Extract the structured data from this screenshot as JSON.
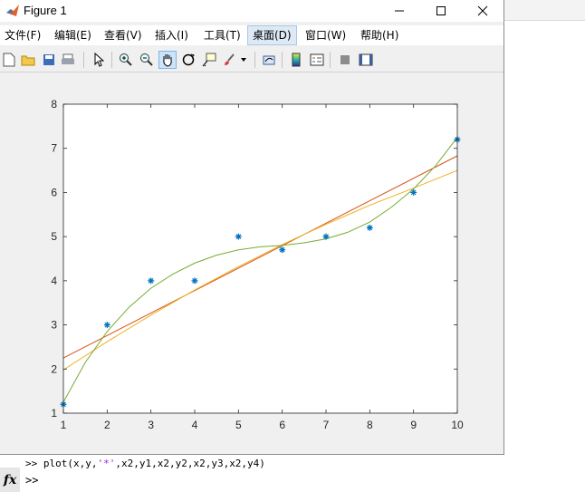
{
  "window": {
    "title": "Figure 1"
  },
  "menu": [
    {
      "label": "文件(F)"
    },
    {
      "label": "编辑(E)"
    },
    {
      "label": "查看(V)"
    },
    {
      "label": "插入(I)"
    },
    {
      "label": "工具(T)"
    },
    {
      "label": "桌面(D)"
    },
    {
      "label": "窗口(W)"
    },
    {
      "label": "帮助(H)"
    }
  ],
  "colors": {
    "markers": "#0072bd",
    "series_red": "#d95319",
    "series_yellow": "#edb120",
    "series_green": "#77ac30"
  },
  "command": {
    "prompt": ">>",
    "line1_prefix": "plot(x,y,",
    "line1_string": "'*'",
    "line1_suffix": ",x2,y1,x2,y2,x2,y3,x2,y4)",
    "line2": ">>",
    "fx": "fx"
  },
  "chart_data": {
    "type": "line",
    "xlim": [
      1,
      10
    ],
    "ylim": [
      1,
      8
    ],
    "xticks": [
      1,
      2,
      3,
      4,
      5,
      6,
      7,
      8,
      9,
      10
    ],
    "yticks": [
      1,
      2,
      3,
      4,
      5,
      6,
      7,
      8
    ],
    "grid": false,
    "markers": {
      "x": [
        1,
        2,
        3,
        4,
        5,
        6,
        7,
        8,
        9,
        10
      ],
      "y": [
        1.2,
        3.0,
        4.0,
        4.0,
        5.0,
        4.7,
        5.0,
        5.2,
        6.0,
        7.2
      ]
    },
    "series": [
      {
        "color": "#d95319",
        "x": [
          1,
          10
        ],
        "y": [
          2.25,
          6.83
        ]
      },
      {
        "color": "#edb120",
        "x": [
          1,
          2,
          3,
          4,
          5,
          6,
          7,
          8,
          9,
          10
        ],
        "y": [
          1.98,
          2.62,
          3.22,
          3.79,
          4.32,
          4.82,
          5.28,
          5.71,
          6.1,
          6.5
        ]
      },
      {
        "color": "#77ac30",
        "x": [
          1,
          1.5,
          2,
          2.5,
          3,
          3.5,
          4,
          4.5,
          5,
          5.5,
          6,
          6.5,
          7,
          7.5,
          8,
          8.5,
          9,
          9.5,
          10
        ],
        "y": [
          1.25,
          2.15,
          2.85,
          3.4,
          3.83,
          4.15,
          4.4,
          4.58,
          4.7,
          4.77,
          4.8,
          4.86,
          4.95,
          5.1,
          5.33,
          5.67,
          6.08,
          6.6,
          7.25
        ]
      }
    ]
  }
}
